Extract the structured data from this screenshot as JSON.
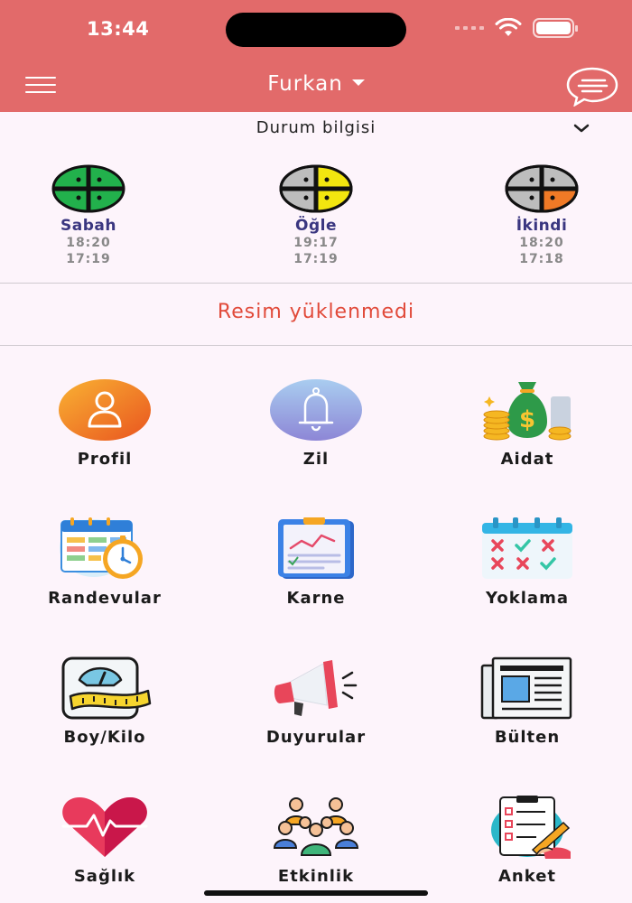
{
  "status_bar": {
    "time": "13:44"
  },
  "header": {
    "user_name": "Furkan"
  },
  "status_section": {
    "title": "Durum bilgisi"
  },
  "prayers": [
    {
      "name": "Sabah",
      "time_1": "18:20",
      "time_2": "17:19",
      "color": "#22b14c"
    },
    {
      "name": "Öğle",
      "time_1": "19:17",
      "time_2": "17:19",
      "color": "#f2e60f"
    },
    {
      "name": "İkindi",
      "time_1": "18:20",
      "time_2": "17:18",
      "color": "#f07a26"
    }
  ],
  "image_notice": "Resim yüklenmedi",
  "menu": [
    {
      "label": "Profil",
      "icon": "profile-icon"
    },
    {
      "label": "Zil",
      "icon": "bell-icon"
    },
    {
      "label": "Aidat",
      "icon": "money-bag-icon"
    },
    {
      "label": "Randevular",
      "icon": "calendar-clock-icon"
    },
    {
      "label": "Karne",
      "icon": "report-card-icon"
    },
    {
      "label": "Yoklama",
      "icon": "attendance-calendar-icon"
    },
    {
      "label": "Boy/Kilo",
      "icon": "scale-measure-icon"
    },
    {
      "label": "Duyurular",
      "icon": "megaphone-icon"
    },
    {
      "label": "Bülten",
      "icon": "newspaper-icon"
    },
    {
      "label": "Sağlık",
      "icon": "heart-pulse-icon"
    },
    {
      "label": "Etkinlik",
      "icon": "group-people-icon"
    },
    {
      "label": "Anket",
      "icon": "survey-clipboard-icon"
    }
  ],
  "colors": {
    "header": "#e26a6a",
    "background": "#fdf4fb",
    "notice": "#e14a3a",
    "prayer_name": "#3a3680"
  }
}
